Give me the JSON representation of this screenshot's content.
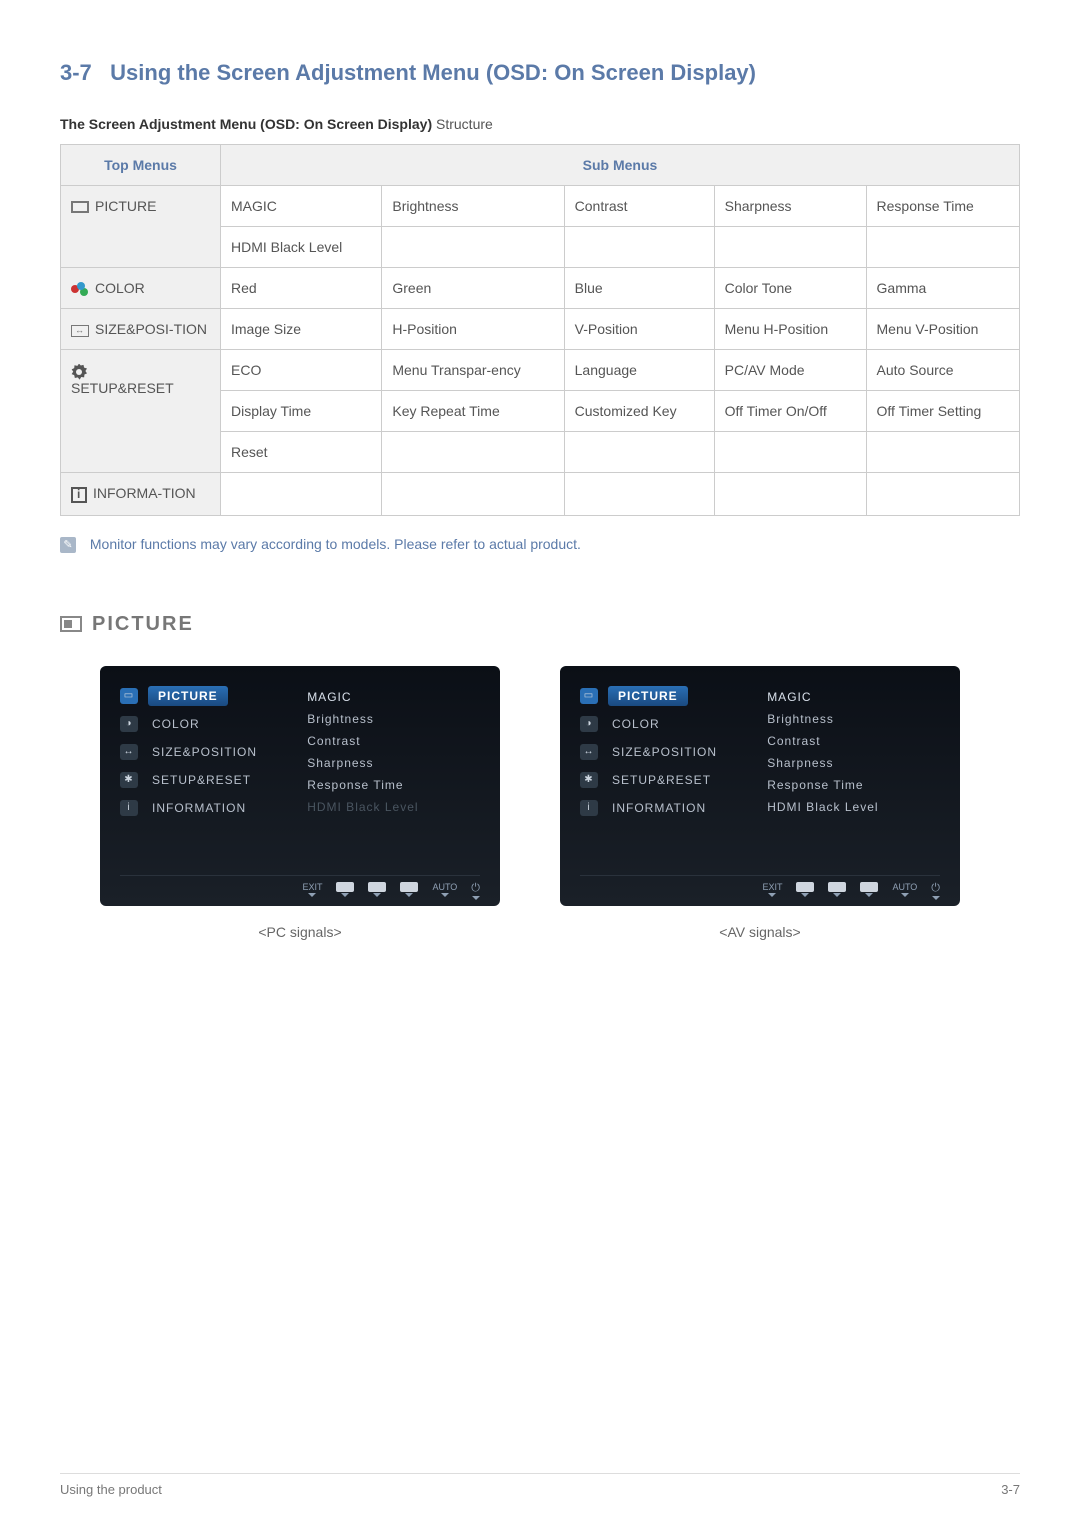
{
  "heading_num": "3-7",
  "heading_text": "Using the Screen Adjustment Menu (OSD: On Screen Display)",
  "structure_bold": "The Screen Adjustment Menu (OSD: On Screen Display)",
  "structure_rest": " Structure",
  "headers": {
    "top": "Top Menus",
    "sub": "Sub Menus"
  },
  "rows": {
    "picture": {
      "label": "PICTURE",
      "r1": [
        "MAGIC",
        "Brightness",
        "Contrast",
        "Sharpness",
        "Response Time"
      ],
      "r2": [
        "HDMI Black Level",
        "",
        "",
        "",
        ""
      ]
    },
    "color": {
      "label": "COLOR",
      "r1": [
        "Red",
        "Green",
        "Blue",
        "Color Tone",
        "Gamma"
      ]
    },
    "size": {
      "label": "SIZE&POSI-TION",
      "r1": [
        "Image Size",
        "H-Position",
        "V-Position",
        "Menu H-Position",
        "Menu V-Position"
      ]
    },
    "setup": {
      "label": "SETUP&RESET",
      "r1": [
        "ECO",
        "Menu Transpar-ency",
        "Language",
        "PC/AV Mode",
        "Auto Source"
      ],
      "r2": [
        "Display Time",
        "Key Repeat Time",
        "Customized Key",
        "Off Timer On/Off",
        "Off Timer Setting"
      ],
      "r3": [
        "Reset",
        "",
        "",
        "",
        ""
      ]
    },
    "info": {
      "label": "INFORMA-TION",
      "r1": [
        "",
        "",
        "",
        "",
        ""
      ]
    }
  },
  "note": "Monitor functions may vary according to models. Please refer to actual product.",
  "section": "PICTURE",
  "osd": {
    "left_items": [
      "PICTURE",
      "COLOR",
      "SIZE&POSITION",
      "SETUP&RESET",
      "INFORMATION"
    ],
    "right_items": [
      "MAGIC",
      "Brightness",
      "Contrast",
      "Sharpness",
      "Response Time",
      "HDMI Black Level"
    ],
    "bottom": [
      "EXIT",
      "",
      "",
      "",
      "AUTO",
      ""
    ],
    "caption_pc": "<PC signals>",
    "caption_av": "<AV signals>"
  },
  "footer_left": "Using the product",
  "footer_right": "3-7"
}
